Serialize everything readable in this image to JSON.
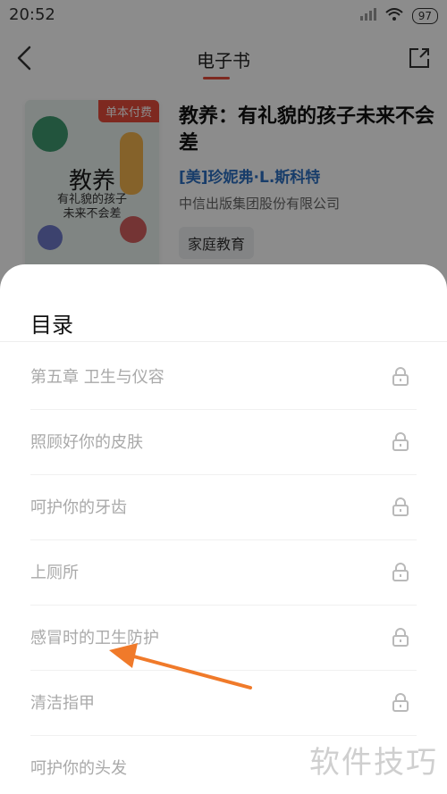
{
  "status": {
    "time": "20:52",
    "battery": "97"
  },
  "topbar": {
    "title": "电子书"
  },
  "book": {
    "cover_badge": "单本付费",
    "cover_title": "教养",
    "cover_subtitle_line1": "有礼貌的孩子",
    "cover_subtitle_line2": "未来不会差",
    "title": "教养：有礼貌的孩子未来不会差",
    "author": "[美]珍妮弗·L.斯科特",
    "publisher": "中信出版集团股份有限公司",
    "tag": "家庭教育"
  },
  "toc": {
    "title": "目录",
    "items": [
      {
        "label": "第五章 卫生与仪容"
      },
      {
        "label": "照顾好你的皮肤"
      },
      {
        "label": "呵护你的牙齿"
      },
      {
        "label": "上厕所"
      },
      {
        "label": "感冒时的卫生防护"
      },
      {
        "label": "清洁指甲"
      },
      {
        "label": "呵护你的头发"
      }
    ]
  },
  "watermark": "软件技巧",
  "colors": {
    "accent": "#e64b3b",
    "author": "#2d6fc1",
    "annotation_arrow": "#f07a2a"
  }
}
